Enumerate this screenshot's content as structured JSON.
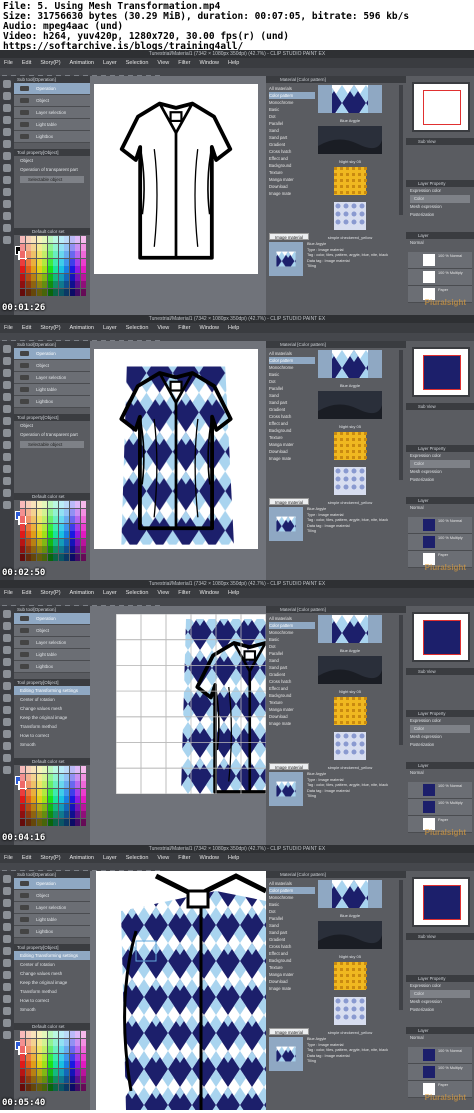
{
  "info": {
    "lines": [
      "File: 5. Using Mesh Transformation.mp4",
      "Size: 31756630 bytes (30.29 MiB), duration: 00:07:05, bitrate: 596 kb/s",
      "Audio: mpeg4aac (und)",
      "Video: h264, yuv420p, 1280x720, 30.00 fps(r) (und)",
      " https://softarchive.is/blogs/training4all/"
    ]
  },
  "app": {
    "title": "Tunestrial/Material1 (7342 × 1080px 350dpi) (42.7%) - CLIP STUDIO PAINT EX",
    "menu": [
      "File",
      "Edit",
      "Story(P)",
      "Animation",
      "Layer",
      "Selection",
      "View",
      "Filter",
      "Window",
      "Help"
    ],
    "subtool_header": "Sub tool[Operation]",
    "subtools": [
      "Operation",
      "Object",
      "Layer selection",
      "Light table",
      "Lightbox"
    ],
    "tool_property_header": "Tool property[Object]",
    "tool_property": {
      "name": "Object",
      "operation_label": "Operation of transparent part",
      "select_label": "Selectable object"
    },
    "transform_property": {
      "header": "Tool property[Object]",
      "title": "Editing Transforming settings",
      "rows": [
        "Center of rotation",
        "Change values mesh",
        "Keep the original image",
        "Transform method",
        "How to correct",
        "Smooth"
      ]
    },
    "color_header": "Default color set",
    "materials": {
      "header": "Material [Color pattern]",
      "tree": [
        "All materials",
        "Color pattern",
        "Monochrome",
        "Basic",
        "Dot",
        "Parallel",
        "Sand",
        "Sand part",
        "Gradient",
        "Cross hatch",
        "Effect and",
        "Background",
        "Texture",
        "Manga mater",
        "Download",
        "Image mate"
      ],
      "thumbs": [
        {
          "label": "Blue Argyle",
          "kind": "argyle"
        },
        {
          "label": "Night sky 05",
          "kind": "night"
        },
        {
          "label": "",
          "kind": "yellow"
        },
        {
          "label": "simple checkered_yellow",
          "kind": "flowers"
        }
      ],
      "image_material_button": "Image material",
      "info_lines": [
        "Blue Argyle",
        "Type : Image material",
        "Tag : color, tiles, pattern, argyle, blue, nite, black",
        "Data tag : Image material",
        "Tiling"
      ]
    },
    "right_panel": {
      "subview_header": "Sub View",
      "layer_property_header": "Layer Property",
      "expression_color_label": "Expression color",
      "expression_color_value": "Color",
      "mesh_label": "Mesh expression",
      "posterization_label": "Posterization",
      "posterization_value": "Tone",
      "layer_header": "Layer",
      "blend": "Normal",
      "layers": [
        {
          "name": "100 %  Normal"
        },
        {
          "name": "100 %  Multiply"
        },
        {
          "name": "Paper"
        }
      ]
    }
  },
  "frames": [
    {
      "timestamp": "00:01:26",
      "mode": "shirt"
    },
    {
      "timestamp": "00:02:50",
      "mode": "argyle"
    },
    {
      "timestamp": "00:04:16",
      "mode": "mesh"
    },
    {
      "timestamp": "00:05:40",
      "mode": "zoom"
    }
  ],
  "watermark": "Pluralsight",
  "colors": {
    "argyle_dark": "#1c1f6b",
    "argyle_light": "#a9d4ef",
    "argyle_white": "#ffffff",
    "selection": "#8fa8c3",
    "panel": "#5a5c61"
  }
}
